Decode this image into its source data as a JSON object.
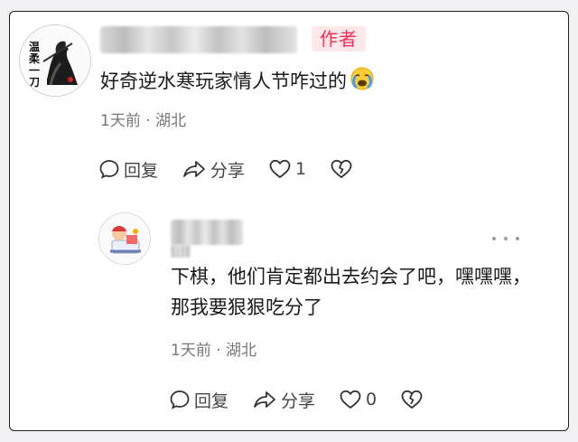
{
  "comment": {
    "author_tag": "作者",
    "text": "好奇逆水寒玩家情人节咋过的",
    "emoji": "crying-face",
    "time": "1天前",
    "separator": "·",
    "location": "湖北",
    "reply_label": "回复",
    "share_label": "分享",
    "like_count": "1",
    "avatar_text": "温柔一刀"
  },
  "reply": {
    "text": "下棋，他们肯定都出去约会了吧，嘿嘿嘿，那我要狠狠吃分了",
    "time": "1天前",
    "separator": "·",
    "location": "湖北",
    "reply_label": "回复",
    "share_label": "分享",
    "like_count": "0"
  },
  "colors": {
    "author_tag_text": "#ff2d55",
    "author_tag_bg": "#ffe7ea"
  }
}
